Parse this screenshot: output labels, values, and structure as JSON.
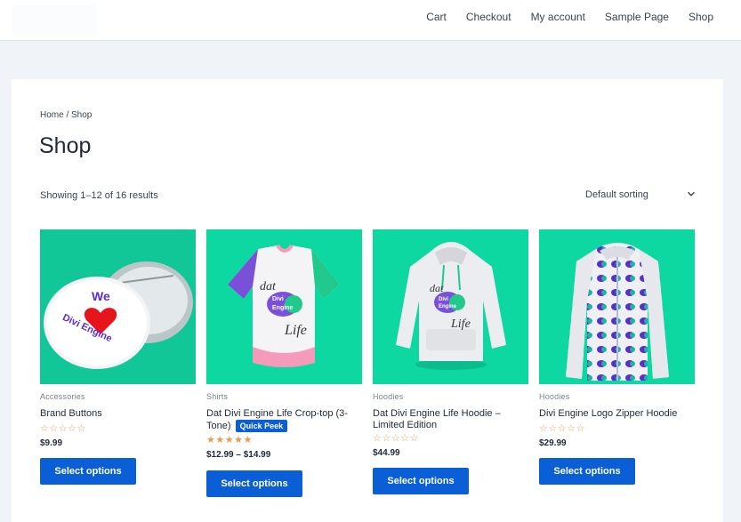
{
  "nav": {
    "items": [
      "Cart",
      "Checkout",
      "My account",
      "Sample Page",
      "Shop"
    ]
  },
  "breadcrumb": "Home / Shop",
  "page_title": "Shop",
  "result_count": "Showing 1–12 of 16 results",
  "sorting": {
    "selected": "Default sorting"
  },
  "icons": {
    "sort": "chevron-down-icon",
    "rating": "star-icon"
  },
  "colors": {
    "accent": "#0b5fd6",
    "thumb_bg": "#0ed8a1",
    "star": "#f2984a"
  },
  "products": [
    {
      "category": "Accessories",
      "name": "Brand Buttons",
      "rating": 0,
      "price": "$9.99",
      "button": "Select options",
      "badge_text": [
        "We",
        "Divi Engine"
      ]
    },
    {
      "category": "Shirts",
      "name": "Dat Divi Engine Life Crop-top (3-Tone)",
      "quick_peek": "Quick Peek",
      "rating": 5,
      "price": "$12.99 – $14.99",
      "button": "Select options",
      "print_text": [
        "dat",
        "Divi",
        "Engine",
        "Life"
      ]
    },
    {
      "category": "Hoodies",
      "name": "Dat Divi Engine Life Hoodie – Limited Edition",
      "rating": 0,
      "price": "$44.99",
      "button": "Select options",
      "print_text": [
        "dat",
        "Divi",
        "Engine",
        "Life"
      ]
    },
    {
      "category": "Hoodies",
      "name": "Divi Engine Logo Zipper Hoodie",
      "rating": 0,
      "price": "$29.99",
      "button": "Select options"
    }
  ]
}
